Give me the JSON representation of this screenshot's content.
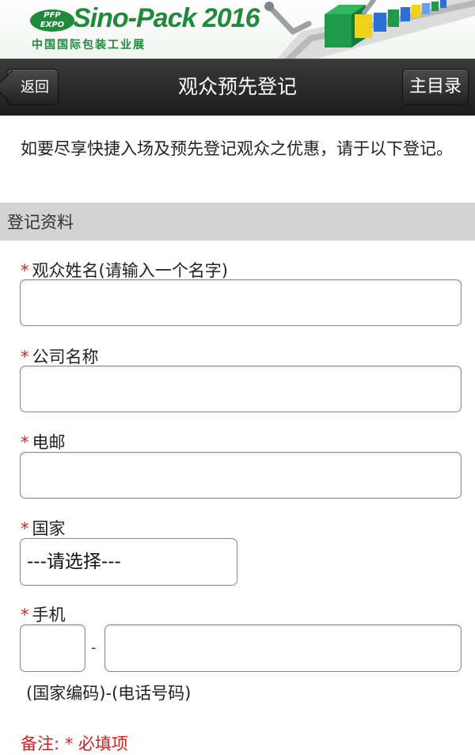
{
  "banner": {
    "badge_line1": "PFP",
    "badge_line2": "EXPO",
    "title": "Sino-Pack 2016",
    "subtitle": "中国国际包装工业展"
  },
  "header": {
    "back_label": "返回",
    "title": "观众预先登记",
    "home_label": "主目录"
  },
  "intro": "如要尽享快捷入场及预先登记观众之优惠，请于以下登记。",
  "section": {
    "title": "登记资料"
  },
  "form": {
    "required_mark": "*",
    "name_label": "观众姓名(请输入一个名字)",
    "name_value": "",
    "company_label": "公司名称",
    "company_value": "",
    "email_label": "电邮",
    "email_value": "",
    "country_label": "国家",
    "country_selected": "---请选择---",
    "mobile_label": "手机",
    "mobile_code_value": "",
    "mobile_separator": "-",
    "mobile_number_value": "",
    "mobile_hint": "(国家编码)-(电话号码)"
  },
  "note": "备注: * 必填项",
  "colors": {
    "brand_green": "#1f8a3a",
    "required_red": "#d62020",
    "header_dark": "#2a2a2a",
    "section_gray": "#d3d3d3"
  }
}
